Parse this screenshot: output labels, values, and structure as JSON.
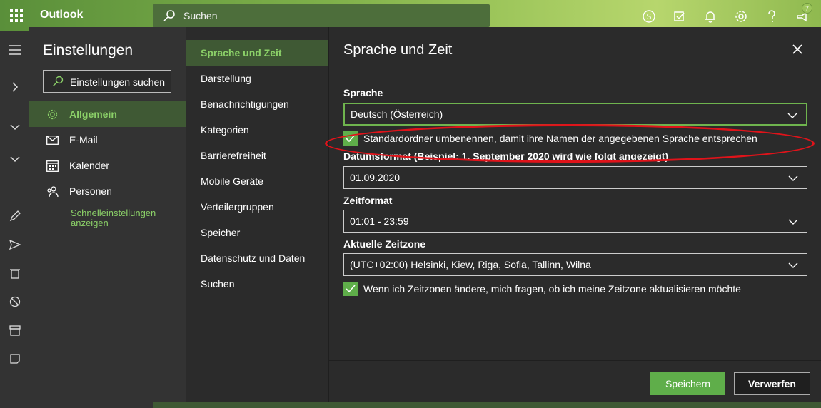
{
  "topbar": {
    "app_title": "Outlook",
    "search_placeholder": "Suchen",
    "notification_count": "7"
  },
  "settings": {
    "title": "Einstellungen",
    "search_label": "Einstellungen suchen",
    "categories": [
      {
        "label": "Allgemein",
        "icon": "gear-icon",
        "active": true
      },
      {
        "label": "E-Mail",
        "icon": "mail-icon",
        "active": false
      },
      {
        "label": "Kalender",
        "icon": "calendar-icon",
        "active": false
      },
      {
        "label": "Personen",
        "icon": "people-icon",
        "active": false
      }
    ],
    "quick_settings_link": "Schnelleinstellungen anzeigen"
  },
  "subnav": {
    "items": [
      "Sprache und Zeit",
      "Darstellung",
      "Benachrichtigungen",
      "Kategorien",
      "Barrierefreiheit",
      "Mobile Geräte",
      "Verteilergruppen",
      "Speicher",
      "Datenschutz und Daten",
      "Suchen"
    ],
    "active_index": 0
  },
  "pane": {
    "title": "Sprache und Zeit",
    "language_label": "Sprache",
    "language_value": "Deutsch (Österreich)",
    "rename_folders_label": "Standardordner umbenennen, damit ihre Namen der angegebenen Sprache entsprechen",
    "rename_folders_checked": true,
    "date_format_label": "Datumsformat (Beispiel: 1. September 2020 wird wie folgt angezeigt)",
    "date_format_value": "01.09.2020",
    "time_format_label": "Zeitformat",
    "time_format_value": "01:01 - 23:59",
    "timezone_label": "Aktuelle Zeitzone",
    "timezone_value": "(UTC+02:00) Helsinki, Kiew, Riga, Sofia, Tallinn, Wilna",
    "ask_timezone_label": "Wenn ich Zeitzonen ändere, mich fragen, ob ich meine Zeitzone aktualisieren möchte",
    "ask_timezone_checked": true,
    "save_label": "Speichern",
    "discard_label": "Verwerfen"
  },
  "colors": {
    "accent": "#5fae4a",
    "accent_text": "#8bd068",
    "annotation": "#e0131a"
  }
}
